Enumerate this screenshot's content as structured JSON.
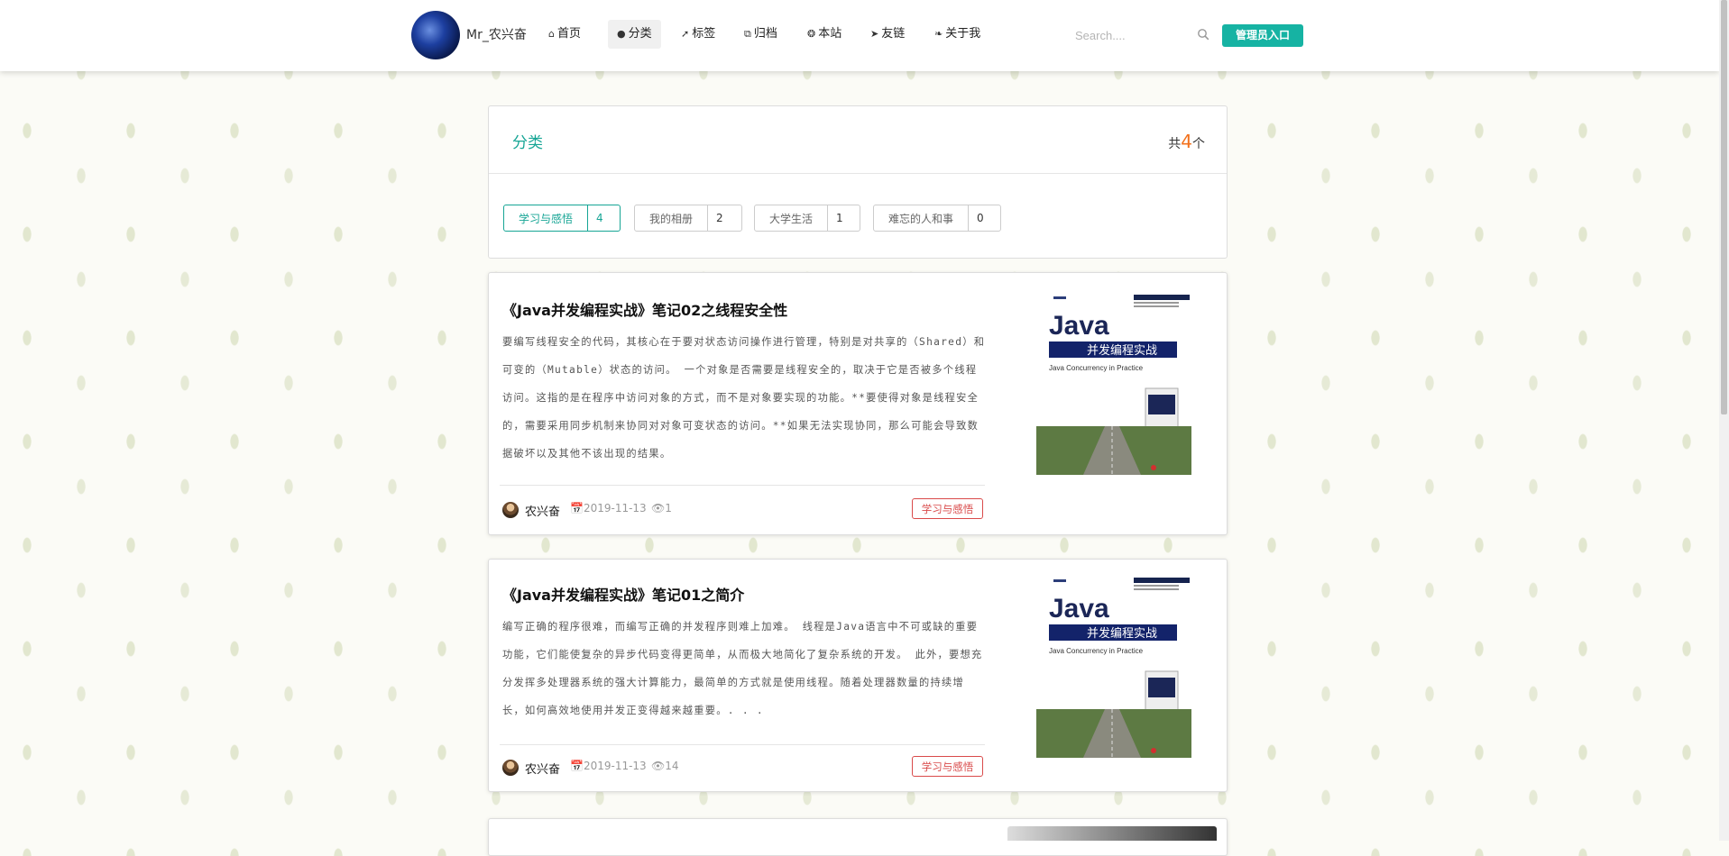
{
  "header": {
    "site_name": "Mr_农兴奋",
    "nav": [
      {
        "label": "首页",
        "icon": "home-icon"
      },
      {
        "label": "分类",
        "icon": "idea-icon",
        "active": true
      },
      {
        "label": "标签",
        "icon": "tags-icon"
      },
      {
        "label": "归档",
        "icon": "clone-icon"
      },
      {
        "label": "本站",
        "icon": "film-icon"
      },
      {
        "label": "友链",
        "icon": "fish-icon"
      },
      {
        "label": "关于我",
        "icon": "plant-icon"
      }
    ],
    "search_placeholder": "Search....",
    "admin_label": "管理员入口"
  },
  "categories_panel": {
    "title": "分类",
    "count_prefix": "共",
    "count": "4",
    "count_suffix": "个",
    "items": [
      {
        "name": "学习与感悟",
        "count": "4",
        "active": true
      },
      {
        "name": "我的相册",
        "count": "2"
      },
      {
        "name": "大学生活",
        "count": "1"
      },
      {
        "name": "难忘的人和事",
        "count": "0"
      }
    ]
  },
  "posts": [
    {
      "title": "《Java并发编程实战》笔记02之线程安全性",
      "description": "要编写线程安全的代码，其核心在于要对状态访问操作进行管理，特别是对共享的（Shared）和可变的（Mutable）状态的访问。 一个对象是否需要是线程安全的，取决于它是否被多个线程访问。这指的是在程序中访问对象的方式，而不是对象要实现的功能。**要使得对象是线程安全的，需要采用同步机制来协同对对象可变状态的访问。**如果无法实现协同，那么可能会导致数据破坏以及其他不该出现的结果。",
      "author": "农兴奋",
      "date": "2019-11-13",
      "views": "1",
      "tag": "学习与感悟",
      "cover": {
        "title": "Java",
        "subtitle": "并发编程实战",
        "english": "Java Concurrency in Practice"
      }
    },
    {
      "title": "《Java并发编程实战》笔记01之简介",
      "description": "编写正确的程序很难，而编写正确的并发程序则难上加难。 线程是Java语言中不可或缺的重要功能，它们能使复杂的异步代码变得更简单，从而极大地简化了复杂系统的开发。 此外，要想充分发挥多处理器系统的强大计算能力，最简单的方式就是使用线程。随着处理器数量的持续增长，如何高效地使用并发正变得越来越重要。. . .",
      "author": "农兴奋",
      "date": "2019-11-13",
      "views": "14",
      "tag": "学习与感悟",
      "cover": {
        "title": "Java",
        "subtitle": "并发编程实战",
        "english": "Java Concurrency in Practice"
      }
    }
  ],
  "colors": {
    "accent": "#16a595",
    "admin_button": "#16b3a3",
    "tag_red": "#d94a4a",
    "count_orange": "#f2711c"
  }
}
